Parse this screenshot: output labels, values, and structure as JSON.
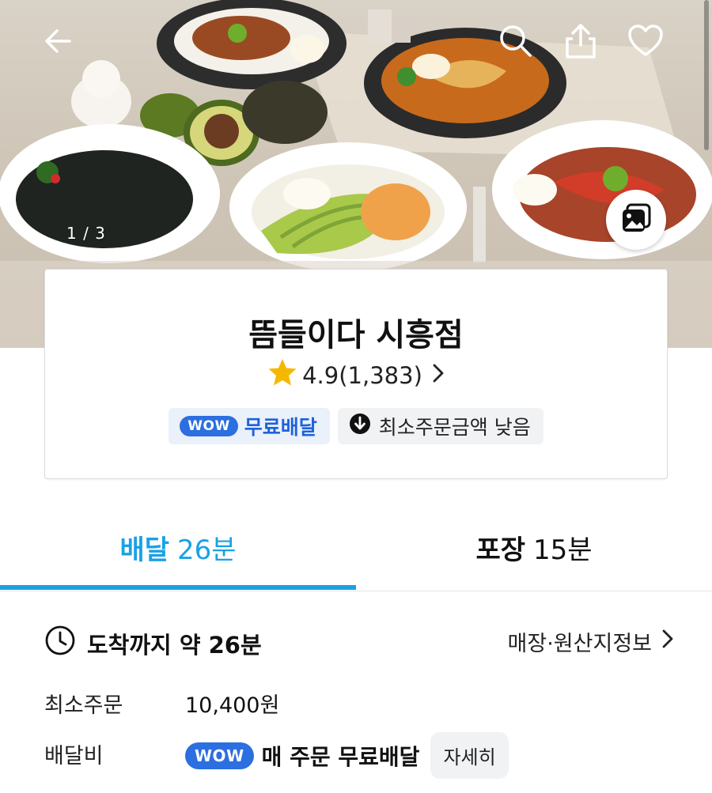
{
  "hero": {
    "image_counter": "1 / 3",
    "icons": {
      "back": "arrow-left-icon",
      "search": "search-icon",
      "share": "share-icon",
      "favorite": "heart-icon",
      "gallery": "photo-gallery-icon"
    }
  },
  "store": {
    "name": "뜸들이다 시흥점",
    "rating": "4.9",
    "review_count": "(1,383)",
    "badges": {
      "wow": "WOW",
      "free_delivery": "무료배달",
      "low_min_order": "최소주문금액 낮음"
    }
  },
  "tabs": [
    {
      "label": "배달",
      "time": "26분",
      "active": true
    },
    {
      "label": "포장",
      "time": "15분",
      "active": false
    }
  ],
  "delivery": {
    "arrival_text": "도착까지 약 26분",
    "origin_link": "매장·원산지정보",
    "min_order_label": "최소주문",
    "min_order_value": "10,400원",
    "fee_label": "배달비",
    "fee_wow": "WOW",
    "fee_text": "매 주문 무료배달",
    "detail_button": "자세히"
  },
  "colors": {
    "accent_blue": "#1aa1e6",
    "wow_blue": "#2b6fe0",
    "star": "#f5b800"
  }
}
